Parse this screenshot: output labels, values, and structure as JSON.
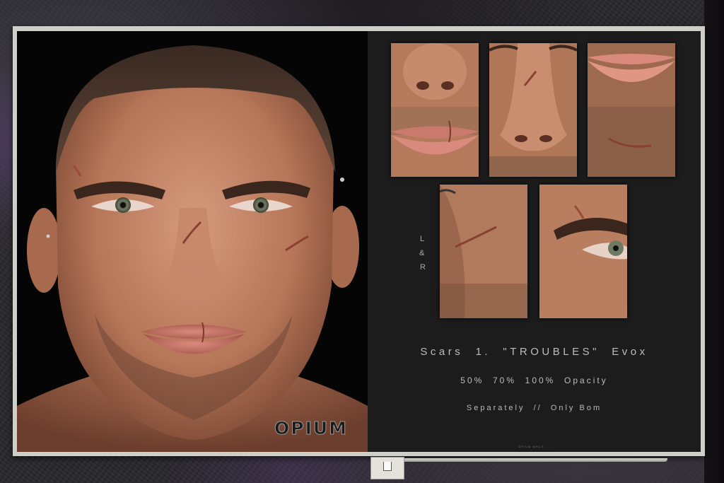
{
  "product": {
    "title": "Scars  1.  \"TROUBLES\"  Evox",
    "opacity_options": "50%  70%  100%  Opacity",
    "availability": "Separately  //  Only Bom",
    "side_letters": [
      "L",
      "&",
      "R"
    ],
    "brand": "OPIUM",
    "footer": "OPIUM MRCS ..."
  },
  "thumbnails": [
    {
      "name": "lip-scar-closeup"
    },
    {
      "name": "nose-bridge-scar-closeup"
    },
    {
      "name": "chin-scar-closeup"
    },
    {
      "name": "cheek-scar-closeup"
    },
    {
      "name": "brow-scar-closeup"
    }
  ],
  "colors": {
    "panel": "#1c1c1d",
    "frame": "#cfcfc9",
    "text": "#bdbdbd",
    "skin": "#c98a6c"
  }
}
